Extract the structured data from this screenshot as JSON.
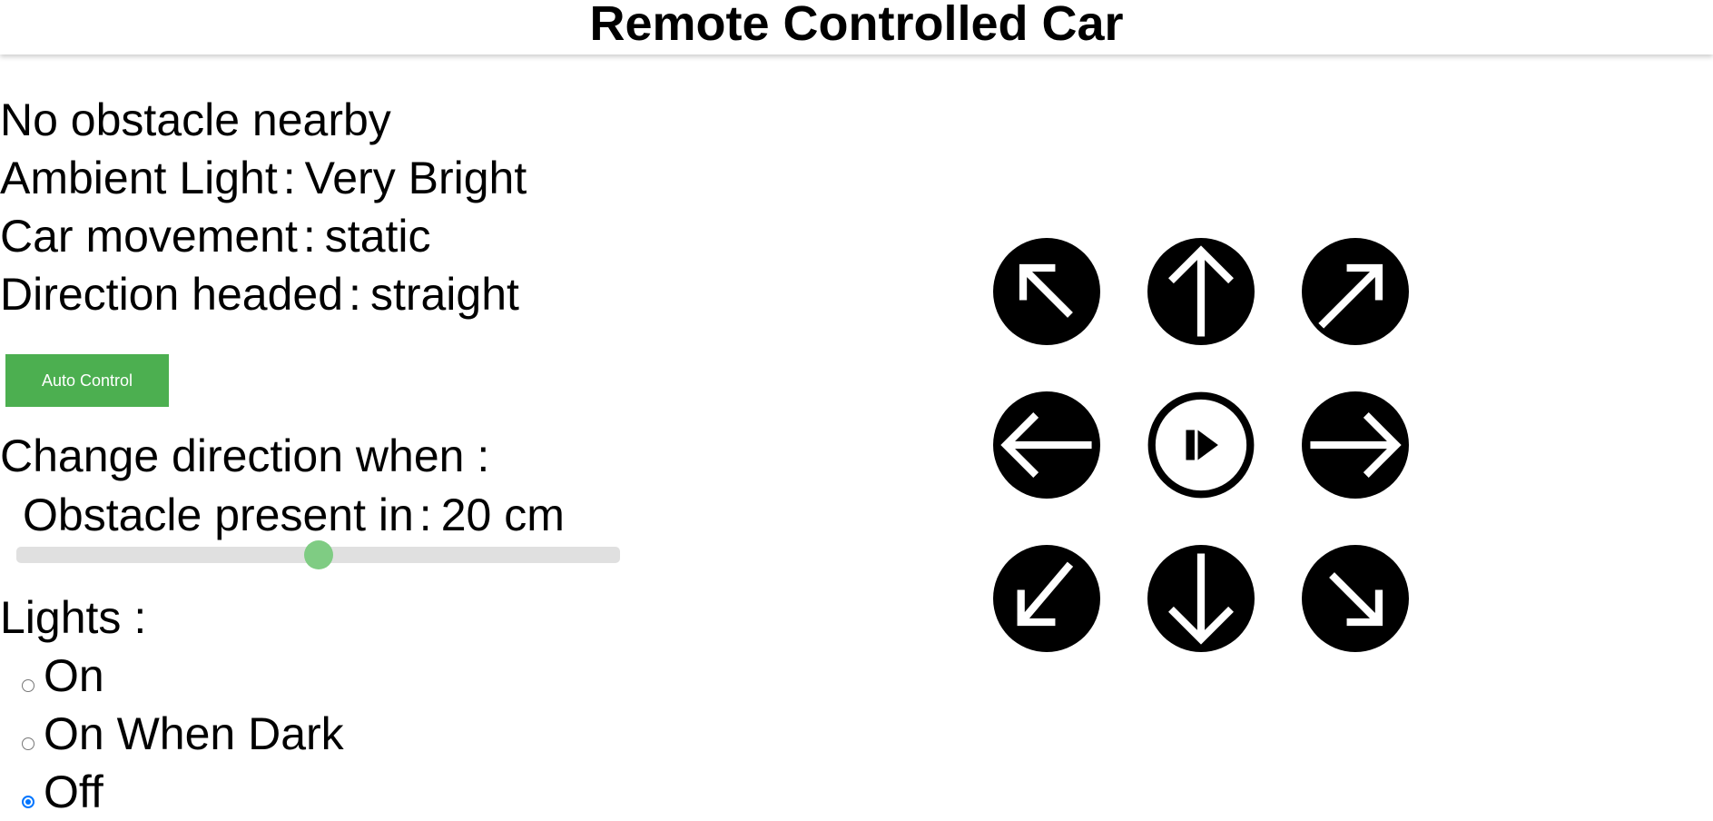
{
  "header": {
    "title": "Remote Controlled Car"
  },
  "status": {
    "obstacle_text": "No obstacle nearby",
    "ambient_light_label": "Ambient Light",
    "ambient_light_value": "Very Bright",
    "car_movement_label": "Car movement",
    "car_movement_value": "static",
    "direction_label": "Direction headed",
    "direction_value": "straight",
    "separator": ":"
  },
  "auto_control": {
    "label": "Auto Control",
    "color": "#4caf50"
  },
  "settings": {
    "change_direction_label": "Change direction when :",
    "obstacle_label": "Obstacle present in",
    "obstacle_value": "20",
    "obstacle_unit": "cm",
    "slider_fraction": 0.5,
    "slider_color": "#7fcc83"
  },
  "lights": {
    "label": "Lights :",
    "options": [
      {
        "label": "On",
        "checked": false
      },
      {
        "label": "On When Dark",
        "checked": false
      },
      {
        "label": "Off",
        "checked": true
      }
    ],
    "accent_color": "#0075ff"
  },
  "controls": {
    "buttons": [
      {
        "name": "up-left",
        "icon": "arrow-up-left-icon"
      },
      {
        "name": "up",
        "icon": "arrow-up-icon"
      },
      {
        "name": "up-right",
        "icon": "arrow-up-right-icon"
      },
      {
        "name": "left",
        "icon": "arrow-left-icon"
      },
      {
        "name": "stop",
        "icon": "play-pause-icon"
      },
      {
        "name": "right",
        "icon": "arrow-right-icon"
      },
      {
        "name": "down-left",
        "icon": "arrow-down-left-icon"
      },
      {
        "name": "down",
        "icon": "arrow-down-icon"
      },
      {
        "name": "down-right",
        "icon": "arrow-down-right-icon"
      }
    ]
  }
}
